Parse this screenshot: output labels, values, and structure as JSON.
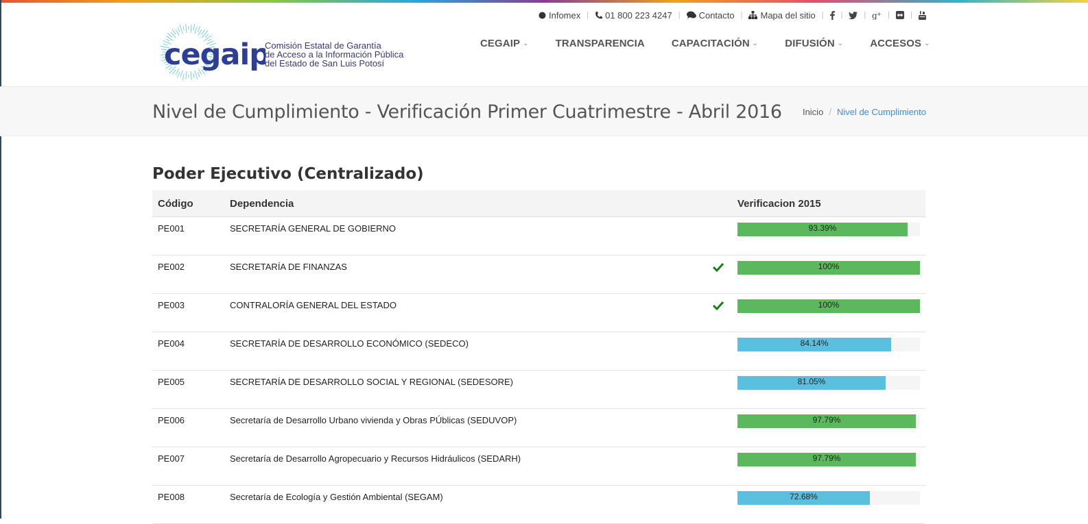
{
  "topbar": {
    "infomex": "Infomex",
    "phone": "01 800 223 4247",
    "contact": "Contacto",
    "sitemap": "Mapa del sitio",
    "socials": [
      "facebook-icon",
      "twitter-icon",
      "google-plus-icon",
      "flickr-icon",
      "youtube-icon"
    ]
  },
  "logo": {
    "wordmark": "cegaip",
    "line1": "Comisión Estatal de Garantía",
    "line2": "de Acceso a la Información Pública",
    "line3": "del Estado de San Luis Potosí"
  },
  "nav": [
    {
      "label": "CEGAIP",
      "dropdown": true
    },
    {
      "label": "TRANSPARENCIA",
      "dropdown": false
    },
    {
      "label": "CAPACITACIÓN",
      "dropdown": true
    },
    {
      "label": "DIFUSIÓN",
      "dropdown": true
    },
    {
      "label": "ACCESOS",
      "dropdown": true
    }
  ],
  "page": {
    "title": "Nivel de Cumplimiento - Verificación Primer Cuatrimestre - Abril 2016",
    "breadcrumb": {
      "home": "Inicio",
      "current": "Nivel de Cumplimiento"
    }
  },
  "section": {
    "title": "Poder Ejecutivo (Centralizado)",
    "headers": {
      "code": "Código",
      "dependency": "Dependencia",
      "verification": "Verificacion 2015"
    },
    "rows": [
      {
        "code": "PE001",
        "name": "SECRETARÍA GENERAL DE GOBIERNO",
        "percent": 93.39,
        "label": "93.39%",
        "check": false,
        "status": "success"
      },
      {
        "code": "PE002",
        "name": "SECRETARÍA DE FINANZAS",
        "percent": 100,
        "label": "100%",
        "check": true,
        "status": "success"
      },
      {
        "code": "PE003",
        "name": "CONTRALORÍA GENERAL DEL ESTADO",
        "percent": 100,
        "label": "100%",
        "check": true,
        "status": "success"
      },
      {
        "code": "PE004",
        "name": "SECRETARÍA DE DESARROLLO ECONÓMICO (SEDECO)",
        "percent": 84.14,
        "label": "84.14%",
        "check": false,
        "status": "info"
      },
      {
        "code": "PE005",
        "name": "SECRETARÍA DE DESARROLLO SOCIAL Y REGIONAL (SEDESORE)",
        "percent": 81.05,
        "label": "81.05%",
        "check": false,
        "status": "info"
      },
      {
        "code": "PE006",
        "name": "Secretaría de Desarrollo Urbano vivienda y Obras PÚblicas (SEDUVOP)",
        "percent": 97.79,
        "label": "97.79%",
        "check": false,
        "status": "success"
      },
      {
        "code": "PE007",
        "name": "Secretaría de Desarrollo Agropecuario y Recursos Hidráulicos (SEDARH)",
        "percent": 97.79,
        "label": "97.79%",
        "check": false,
        "status": "success"
      },
      {
        "code": "PE008",
        "name": "Secretaría de Ecología y Gestión Ambiental (SEGAM)",
        "percent": 72.68,
        "label": "72.68%",
        "check": false,
        "status": "info"
      }
    ]
  },
  "colors": {
    "success": "#5cb85c",
    "info": "#5bc0de",
    "check": "#1a7f1a",
    "link": "#3b8fd6"
  }
}
